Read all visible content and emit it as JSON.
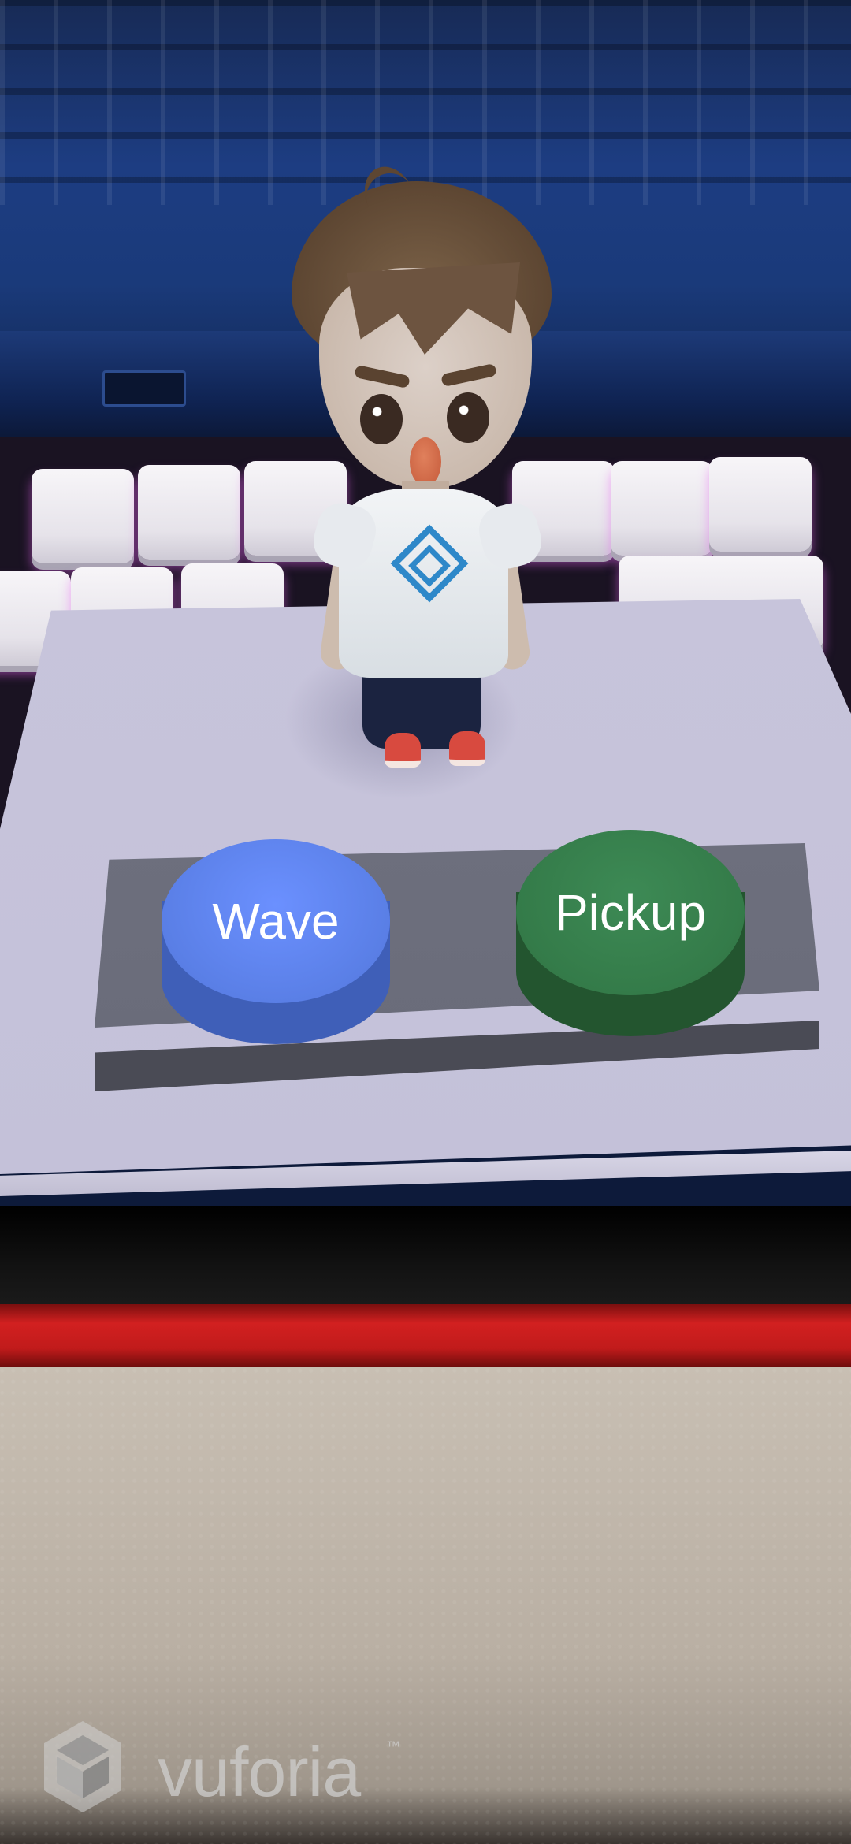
{
  "buttons": {
    "wave_label": "Wave",
    "pickup_label": "Pickup",
    "wave_color": "#5a7fe6",
    "pickup_color": "#347b49"
  },
  "watermark": {
    "brand": "vuforia",
    "trademark": "™",
    "icon": "vuforia-logo-icon"
  },
  "character": {
    "shirt_icon": "spiral-logo-icon"
  }
}
